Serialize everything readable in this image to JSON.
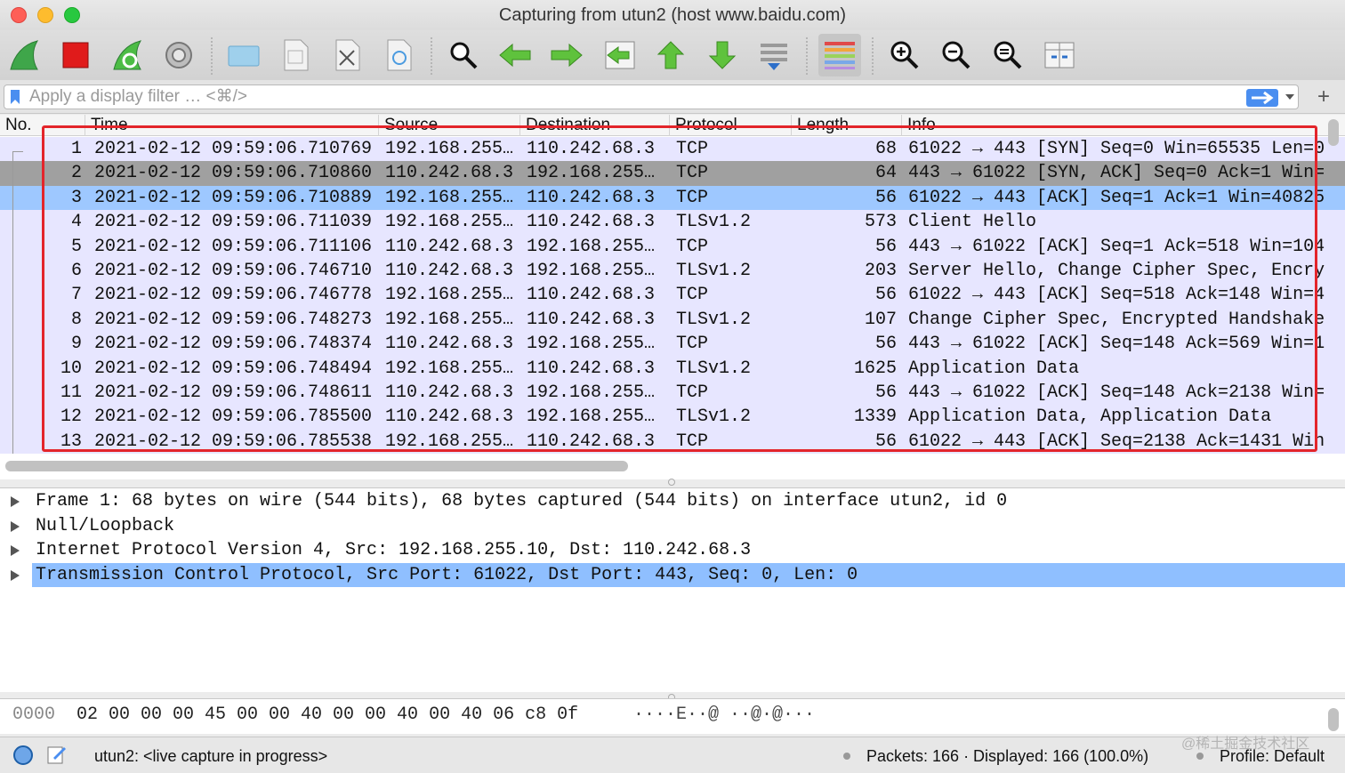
{
  "window": {
    "title": "Capturing from utun2 (host www.baidu.com)"
  },
  "toolbar": {
    "buttons": [
      {
        "name": "start-capture",
        "icon": "shark-fin-icon"
      },
      {
        "name": "stop-capture",
        "icon": "stop-icon"
      },
      {
        "name": "restart-capture",
        "icon": "restart-fin-icon"
      },
      {
        "name": "capture-options",
        "icon": "gear-icon"
      },
      {
        "name": "open-file",
        "icon": "folder-icon"
      },
      {
        "name": "save-file",
        "icon": "file-icon"
      },
      {
        "name": "close-file",
        "icon": "close-file-icon"
      },
      {
        "name": "reload-file",
        "icon": "reload-icon"
      },
      {
        "name": "find-packet",
        "icon": "magnifier-icon"
      },
      {
        "name": "go-back",
        "icon": "arrow-left-icon"
      },
      {
        "name": "go-forward",
        "icon": "arrow-right-icon"
      },
      {
        "name": "go-to-packet",
        "icon": "jump-icon"
      },
      {
        "name": "first-packet",
        "icon": "arrow-up-icon"
      },
      {
        "name": "last-packet",
        "icon": "arrow-down-icon"
      },
      {
        "name": "autoscroll",
        "icon": "autoscroll-icon"
      },
      {
        "name": "colorize",
        "icon": "colorize-icon"
      },
      {
        "name": "zoom-in",
        "icon": "zoom-in-icon"
      },
      {
        "name": "zoom-out",
        "icon": "zoom-out-icon"
      },
      {
        "name": "normal-size",
        "icon": "zoom-reset-icon"
      },
      {
        "name": "resize-columns",
        "icon": "resize-columns-icon"
      }
    ]
  },
  "filter": {
    "placeholder": "Apply a display filter … <⌘/>",
    "value": ""
  },
  "packet_list": {
    "columns": [
      "No.",
      "Time",
      "Source",
      "Destination",
      "Protocol",
      "Length",
      "Info"
    ],
    "rows": [
      {
        "no": "1",
        "time": "2021-02-12 09:59:06.710769",
        "src": "192.168.255…",
        "dst": "110.242.68.3",
        "proto": "TCP",
        "len": "68",
        "info": "61022 → 443 [SYN] Seq=0 Win=65535 Len=0",
        "bg": "lav"
      },
      {
        "no": "2",
        "time": "2021-02-12 09:59:06.710860",
        "src": "110.242.68.3",
        "dst": "192.168.255…",
        "proto": "TCP",
        "len": "64",
        "info": "443 → 61022 [SYN, ACK] Seq=0 Ack=1 Win=",
        "bg": "grey"
      },
      {
        "no": "3",
        "time": "2021-02-12 09:59:06.710889",
        "src": "192.168.255…",
        "dst": "110.242.68.3",
        "proto": "TCP",
        "len": "56",
        "info": "61022 → 443 [ACK] Seq=1 Ack=1 Win=40825",
        "bg": "blue"
      },
      {
        "no": "4",
        "time": "2021-02-12 09:59:06.711039",
        "src": "192.168.255…",
        "dst": "110.242.68.3",
        "proto": "TLSv1.2",
        "len": "573",
        "info": "Client Hello",
        "bg": "lav"
      },
      {
        "no": "5",
        "time": "2021-02-12 09:59:06.711106",
        "src": "110.242.68.3",
        "dst": "192.168.255…",
        "proto": "TCP",
        "len": "56",
        "info": "443 → 61022 [ACK] Seq=1 Ack=518 Win=104",
        "bg": "lav"
      },
      {
        "no": "6",
        "time": "2021-02-12 09:59:06.746710",
        "src": "110.242.68.3",
        "dst": "192.168.255…",
        "proto": "TLSv1.2",
        "len": "203",
        "info": "Server Hello, Change Cipher Spec, Encry",
        "bg": "lav"
      },
      {
        "no": "7",
        "time": "2021-02-12 09:59:06.746778",
        "src": "192.168.255…",
        "dst": "110.242.68.3",
        "proto": "TCP",
        "len": "56",
        "info": "61022 → 443 [ACK] Seq=518 Ack=148 Win=4",
        "bg": "lav"
      },
      {
        "no": "8",
        "time": "2021-02-12 09:59:06.748273",
        "src": "192.168.255…",
        "dst": "110.242.68.3",
        "proto": "TLSv1.2",
        "len": "107",
        "info": "Change Cipher Spec, Encrypted Handshake",
        "bg": "lav"
      },
      {
        "no": "9",
        "time": "2021-02-12 09:59:06.748374",
        "src": "110.242.68.3",
        "dst": "192.168.255…",
        "proto": "TCP",
        "len": "56",
        "info": "443 → 61022 [ACK] Seq=148 Ack=569 Win=1",
        "bg": "lav"
      },
      {
        "no": "10",
        "time": "2021-02-12 09:59:06.748494",
        "src": "192.168.255…",
        "dst": "110.242.68.3",
        "proto": "TLSv1.2",
        "len": "1625",
        "info": "Application Data",
        "bg": "lav"
      },
      {
        "no": "11",
        "time": "2021-02-12 09:59:06.748611",
        "src": "110.242.68.3",
        "dst": "192.168.255…",
        "proto": "TCP",
        "len": "56",
        "info": "443 → 61022 [ACK] Seq=148 Ack=2138 Win=",
        "bg": "lav"
      },
      {
        "no": "12",
        "time": "2021-02-12 09:59:06.785500",
        "src": "110.242.68.3",
        "dst": "192.168.255…",
        "proto": "TLSv1.2",
        "len": "1339",
        "info": "Application Data, Application Data",
        "bg": "lav"
      },
      {
        "no": "13",
        "time": "2021-02-12 09:59:06.785538",
        "src": "192.168.255…",
        "dst": "110.242.68.3",
        "proto": "TCP",
        "len": "56",
        "info": "61022 → 443 [ACK] Seq=2138 Ack=1431 Win",
        "bg": "lav"
      }
    ]
  },
  "details": {
    "items": [
      "Frame 1: 68 bytes on wire (544 bits), 68 bytes captured (544 bits) on interface utun2, id 0",
      "Null/Loopback",
      "Internet Protocol Version 4, Src: 192.168.255.10, Dst: 110.242.68.3",
      "Transmission Control Protocol, Src Port: 61022, Dst Port: 443, Seq: 0, Len: 0"
    ],
    "selected_index": 3
  },
  "bytes": {
    "offset": "0000",
    "hex": "02 00 00 00 45 00 00 40  00 00 40 00 40 06 c8 0f",
    "ascii": "····E··@ ··@·@···"
  },
  "status": {
    "interface": "utun2: <live capture in progress>",
    "packets": "Packets: 166 · Displayed: 166 (100.0%)",
    "profile": "Profile: Default",
    "watermark": "@稀土掘金技术社区"
  },
  "colors": {
    "row_default": "#e7e6ff",
    "row_grey": "#a0a0a0",
    "row_selected": "#9ec8ff",
    "highlight_box": "#e3252b"
  }
}
